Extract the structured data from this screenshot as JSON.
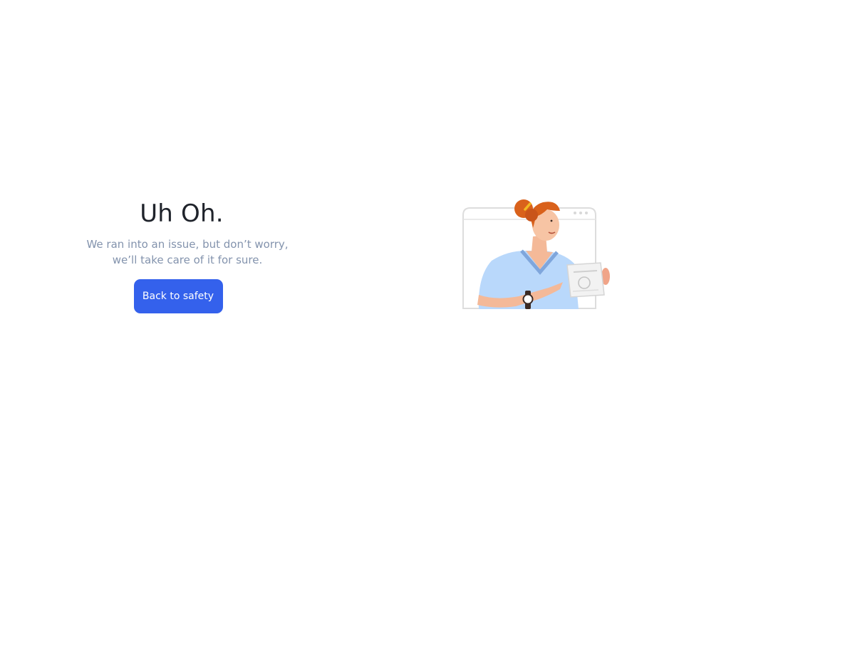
{
  "error_page": {
    "title": "Uh Oh.",
    "message_line_1": "We ran into an issue, but don’t worry,",
    "message_line_2": "we’ll take care of it for sure.",
    "cta_label": "Back to safety"
  },
  "colors": {
    "accent": "#3461ec",
    "heading": "#1f232b",
    "muted_text": "#8393ad",
    "background": "#ffffff",
    "hair": "#d9611b",
    "shirt": "#b9d8fb"
  },
  "illustration": {
    "icon": "support-person-illustration"
  }
}
